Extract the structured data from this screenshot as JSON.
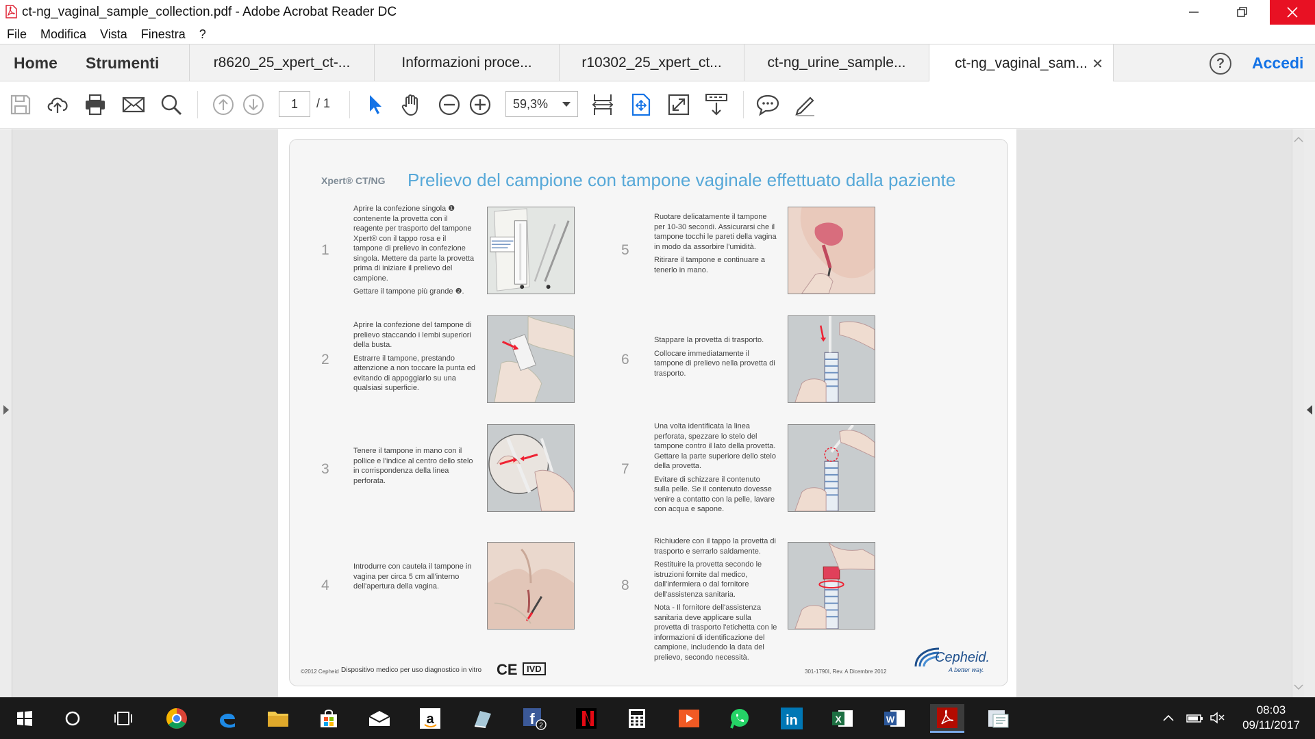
{
  "window": {
    "title": "ct-ng_vaginal_sample_collection.pdf - Adobe Acrobat Reader DC"
  },
  "menu": [
    {
      "label": "File",
      "key": "F"
    },
    {
      "label": "Modifica",
      "key": "M"
    },
    {
      "label": "Vista",
      "key": "V"
    },
    {
      "label": "Finestra",
      "key": "n"
    },
    {
      "label": "?",
      "key": "?"
    }
  ],
  "nav": {
    "home": "Home",
    "tools": "Strumenti",
    "signin": "Accedi"
  },
  "tabs": [
    {
      "label": "r8620_25_xpert_ct-..."
    },
    {
      "label": "Informazioni proce..."
    },
    {
      "label": "r10302_25_xpert_ct..."
    },
    {
      "label": "ct-ng_urine_sample..."
    },
    {
      "label": "ct-ng_vaginal_sam...",
      "active": true
    }
  ],
  "toolbar": {
    "page_current": "1",
    "page_total": "/ 1",
    "zoom": "59,3%",
    "icons": [
      "save-icon",
      "upload-icon",
      "print-icon",
      "email-icon",
      "search-icon",
      "prev-page-icon",
      "next-page-icon",
      "select-cursor-icon",
      "hand-icon",
      "zoom-out-icon",
      "zoom-in-icon",
      "fit-page-icon",
      "full-screen-icon",
      "rotate-icon",
      "scroll-mode-icon",
      "comment-icon",
      "sign-icon"
    ]
  },
  "document": {
    "brand": "Xpert® CT/NG",
    "title": "Prelievo del campione con tampone vaginale effettuato dalla paziente",
    "steps": [
      {
        "num": "1",
        "paragraphs": [
          "Aprire la confezione singola ❶ contenente la provetta con il reagente per trasporto del tampone Xpert® con il tappo rosa e il tampone di prelievo in confezione singola. Mettere da parte la provetta prima di iniziare il prelievo del campione.",
          "Gettare il tampone più grande ❷."
        ]
      },
      {
        "num": "2",
        "paragraphs": [
          "Aprire la confezione del tampone di prelievo staccando i lembi superiori della busta.",
          "Estrarre il tampone, prestando attenzione a non toccare la punta ed evitando di appoggiarlo su una qualsiasi superficie."
        ]
      },
      {
        "num": "3",
        "paragraphs": [
          "Tenere il tampone in mano con il pollice e l'indice al centro dello stelo in corrispondenza della linea perforata."
        ]
      },
      {
        "num": "4",
        "paragraphs": [
          "Introdurre con cautela il tampone in vagina per circa 5 cm all'interno dell'apertura della vagina."
        ]
      },
      {
        "num": "5",
        "paragraphs": [
          "Ruotare delicatamente il tampone per 10-30 secondi. Assicurarsi che il tampone tocchi le pareti della vagina in modo da assorbire l'umidità.",
          "Ritirare il tampone e continuare a tenerlo in mano."
        ]
      },
      {
        "num": "6",
        "paragraphs": [
          "Stappare la provetta di trasporto.",
          "Collocare immediatamente il tampone di prelievo nella provetta di trasporto."
        ]
      },
      {
        "num": "7",
        "paragraphs": [
          "Una volta identificata la linea perforata, spezzare lo stelo del tampone contro il lato della provetta. Gettare la parte superiore dello stelo della provetta.",
          "Evitare di schizzare il contenuto sulla pelle. Se il contenuto dovesse venire a contatto con la pelle, lavare con acqua e sapone."
        ]
      },
      {
        "num": "8",
        "paragraphs": [
          "Richiudere con il tappo la provetta di trasporto e serrarlo saldamente.",
          "Restituire la provetta secondo le istruzioni fornite dal medico, dall'infermiera o dal fornitore dell'assistenza sanitaria.",
          "Nota - Il fornitore dell'assistenza sanitaria deve applicare sulla provetta di trasporto l'etichetta con le informazioni di identificazione del campione, includendo la data del prelievo, secondo necessità."
        ]
      }
    ],
    "footer": {
      "copyright": "©2012 Cepheid",
      "ivd_text": "Dispositivo medico per uso diagnostico in vitro",
      "ce": "CE",
      "ivd_mark": "IVD",
      "revision": "301-1790I, Rev. A Dicembre 2012",
      "logo": "Cepheid.",
      "tagline": "A better way."
    }
  },
  "taskbar": {
    "time": "08:03",
    "date": "09/11/2017",
    "apps": [
      "start-icon",
      "cortana-icon",
      "task-view-icon",
      "chrome-icon",
      "edge-icon",
      "file-explorer-icon",
      "store-icon",
      "mail-icon",
      "amazon-icon",
      "sketch-app-icon",
      "facebook-icon",
      "netflix-icon",
      "calculator-icon",
      "video-app-icon",
      "whatsapp-icon",
      "linkedin-icon",
      "excel-icon",
      "word-icon",
      "acrobat-icon",
      "paint-app-icon"
    ]
  },
  "colors": {
    "accent": "#1473e6",
    "close_red": "#e81123",
    "title_blue": "#56a8d8",
    "cepheid_blue": "#1e4f8c"
  }
}
